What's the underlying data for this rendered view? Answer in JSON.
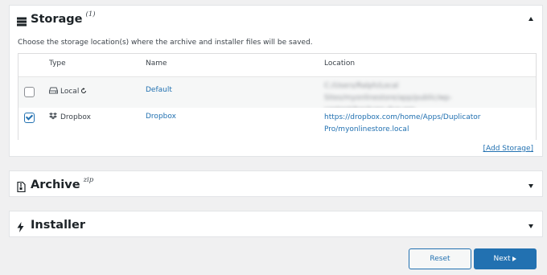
{
  "storage": {
    "title": "Storage",
    "sup": "(1)",
    "description": "Choose the storage location(s) where the archive and installer files will be saved.",
    "columns": {
      "type": "Type",
      "name": "Name",
      "location": "Location"
    },
    "rows": [
      {
        "checked": false,
        "type": "Local",
        "name": "Default",
        "location_line1": "C:/Users/Ralph/Local Sites/myonlinestore/app/public/wp-",
        "location_line2": "content/backups-dup-pro"
      },
      {
        "checked": true,
        "type": "Dropbox",
        "name": "Dropbox",
        "location_line1": "https://dropbox.com/home/Apps/Duplicator",
        "location_line2": "Pro/myonlinestore.local"
      }
    ],
    "add_storage": "[Add Storage]"
  },
  "archive": {
    "title": "Archive",
    "sup": "zip"
  },
  "installer": {
    "title": "Installer"
  },
  "buttons": {
    "reset": "Reset",
    "next": "Next"
  },
  "colors": {
    "accent": "#2271b1",
    "background": "#f0f0f1",
    "panel": "#ffffff"
  }
}
